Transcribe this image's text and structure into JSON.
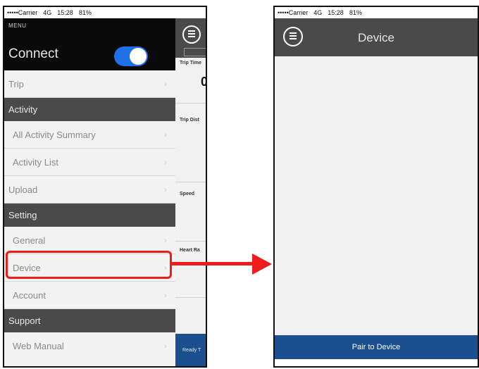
{
  "status_bar": {
    "carrier": "•••••Carrier",
    "network": "4G",
    "time": "15:28",
    "battery": "81%"
  },
  "menu": {
    "header_label": "MENU",
    "connect_label": "Connect",
    "connect_enabled": true,
    "items": [
      {
        "label": "Trip",
        "type": "item",
        "style": "flush"
      },
      {
        "label": "Activity",
        "type": "section"
      },
      {
        "label": "All Activity Summary",
        "type": "item",
        "style": "indent"
      },
      {
        "label": "Activity List",
        "type": "item",
        "style": "indent"
      },
      {
        "label": "Upload",
        "type": "item",
        "style": "flush"
      },
      {
        "label": "Setting",
        "type": "section"
      },
      {
        "label": "General",
        "type": "item",
        "style": "indent"
      },
      {
        "label": "Device",
        "type": "item",
        "style": "indent"
      },
      {
        "label": "Account",
        "type": "item",
        "style": "indent"
      },
      {
        "label": "Support",
        "type": "section"
      },
      {
        "label": "Web Manual",
        "type": "item",
        "style": "indent"
      }
    ]
  },
  "peek": {
    "trip_time_label": "Trip Time",
    "trip_time_value": "0:",
    "trip_distance_label": "Trip Dist",
    "speed_label": "Speed",
    "heart_rate_label": "Heart Ra",
    "bottom_text": "Ready T"
  },
  "device_screen": {
    "title": "Device",
    "pair_button_label": "Pair to Device"
  },
  "colors": {
    "highlight": "#ee1c1c",
    "accent_blue": "#1c4f8f",
    "toggle_on": "#1f6fe8",
    "section_bg": "#4a4a4a"
  }
}
